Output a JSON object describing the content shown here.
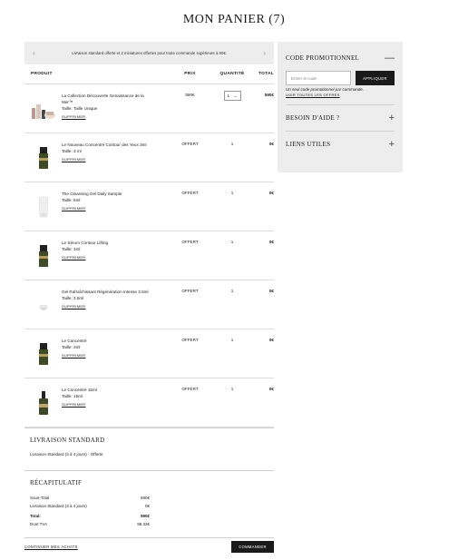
{
  "page": {
    "title": "MON PANIER (7)"
  },
  "banner": {
    "text": "Livraison standard offerte et 2 miniatures offertes pour toute commande supérieure à 90€.",
    "prev_icon": "‹",
    "next_icon": "›"
  },
  "table": {
    "headers": {
      "product": "PRODUIT",
      "price": "PRIX",
      "quantity": "QUANTITÉ",
      "total": "TOTAL"
    },
    "items": [
      {
        "name": "La Collection Découverte Genaissance de la Mer™",
        "size": "Taille: Taille Unique",
        "remove": "SUPPRIMER",
        "price": "590€",
        "qty": "1",
        "total": "590€",
        "thumb": "kit"
      },
      {
        "name": "Le Nouveau Concentré Contour des Yeux 3ml",
        "size": "Taille: 3 ml",
        "remove": "SUPPRIMER",
        "price": "OFFERT",
        "qty": "1",
        "total": "0€",
        "thumb": "tube"
      },
      {
        "name": "The Cleansing Gel Daily Sample",
        "size": "Taille: 5ml",
        "remove": "SUPPRIMER",
        "price": "OFFERT",
        "qty": "1",
        "total": "0€",
        "thumb": "white"
      },
      {
        "name": "Le Sérum Contour Lifting",
        "size": "Taille: 3ml",
        "remove": "SUPPRIMER",
        "price": "OFFERT",
        "qty": "1",
        "total": "0€",
        "thumb": "tube"
      },
      {
        "name": "Gel Rafraîchissant Régénération Intense 3.5ml",
        "size": "Taille: 3.5ml",
        "remove": "SUPPRIMER",
        "price": "OFFERT",
        "qty": "1",
        "total": "0€",
        "thumb": "jar"
      },
      {
        "name": "Le Concentré",
        "size": "Taille: 3ml",
        "remove": "SUPPRIMER",
        "price": "OFFERT",
        "qty": "1",
        "total": "0€",
        "thumb": "tube"
      },
      {
        "name": "Le Concentré 15ml",
        "size": "Taille: 15ml",
        "remove": "SUPPRIMER",
        "price": "OFFERT",
        "qty": "1",
        "total": "0€",
        "thumb": "bottle"
      }
    ]
  },
  "shipping": {
    "title": "LIVRAISON STANDARD",
    "text": "Livraison Standard (3 à 4 jours) - Offerte"
  },
  "recap": {
    "title": "RÉCAPITULATIF",
    "subtotal_label": "Sous-Total",
    "subtotal_value": "590€",
    "shipping_label": "Livraison Standard (3 à 4 jours)",
    "shipping_value": "0€",
    "total_label": "Total:",
    "total_value": "590€",
    "vat_label": "Dont TVA",
    "vat_value": "98.33€"
  },
  "footer": {
    "continue": "CONTINUER MES ACHATS",
    "order": "COMMANDER"
  },
  "sidebar": {
    "promo_title": "CODE PROMOTIONNEL",
    "promo_placeholder": "Entrer le code",
    "promo_button": "APPLIQUER",
    "promo_note": "Un seul code promotionnel par commande.",
    "promo_link": "VOIR TOUTES LES OFFRES",
    "help_title": "BESOIN D'AIDE ?",
    "links_title": "LIENS UTILES",
    "minus_icon": "—",
    "plus_icon": "+"
  }
}
